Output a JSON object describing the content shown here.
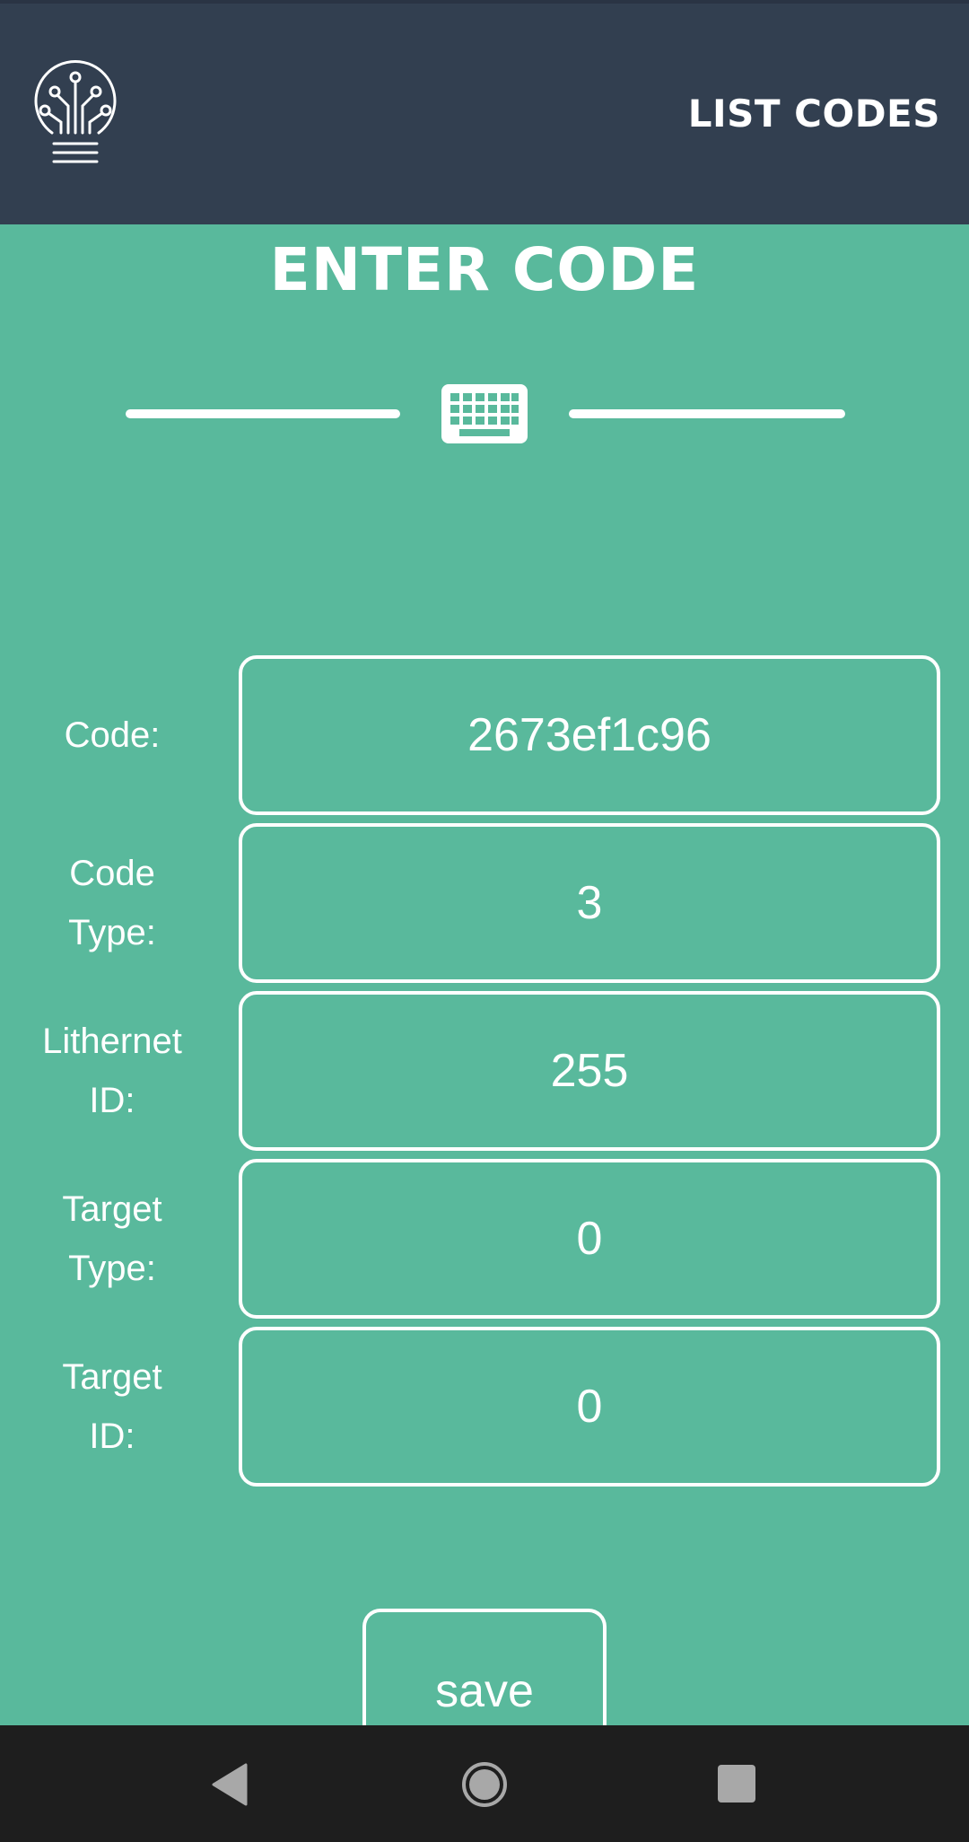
{
  "header": {
    "logo_icon": "lightbulb-circuit-icon",
    "list_codes_label": "LIST CODES",
    "background_color": "#323f50"
  },
  "page": {
    "title": "ENTER CODE",
    "divider_icon": "keyboard-icon",
    "background_color": "#59b99c"
  },
  "fields": [
    {
      "label": "Code:",
      "value": "2673ef1c96"
    },
    {
      "label": "Code\nType:",
      "value": "3"
    },
    {
      "label": "Lithernet\nID:",
      "value": "255"
    },
    {
      "label": "Target\nType:",
      "value": "0"
    },
    {
      "label": "Target\nID:",
      "value": "0"
    }
  ],
  "save_button": {
    "label": "save"
  },
  "navbar": {
    "back_icon": "back-triangle-icon",
    "home_icon": "home-circle-icon",
    "recent_icon": "recent-apps-square-icon"
  }
}
